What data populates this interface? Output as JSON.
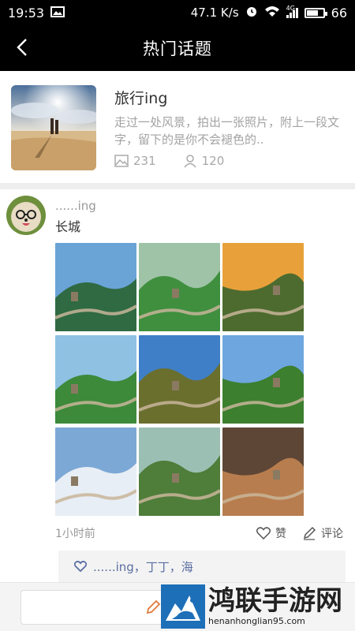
{
  "status": {
    "time": "19:53",
    "speed": "47.1 K/s",
    "network": "4G",
    "battery": "66",
    "battery_level": 0.66
  },
  "nav": {
    "title": "热门话题"
  },
  "topic": {
    "name": "旅行ing",
    "description": "走过一处风景，拍出一张照片，附上一段文字，留下的是你不会褪色的..",
    "photo_count": "231",
    "member_count": "120"
  },
  "post": {
    "username": "......ing",
    "content": "长城",
    "time": "1小时前",
    "like_label": "赞",
    "comment_label": "评论",
    "liked_by": "......ing，丁丁，海",
    "photos": [
      {
        "name": "photo-1",
        "sky": "#6aa3d6",
        "ground": "#2f6a42",
        "alt": "Great Wall ridge"
      },
      {
        "name": "photo-2",
        "sky": "#9fc3a6",
        "ground": "#3f8f3f",
        "alt": "Great Wall green hills"
      },
      {
        "name": "photo-3",
        "sky": "#e8a13a",
        "ground": "#4d6b2f",
        "alt": "Great Wall at sunset"
      },
      {
        "name": "photo-4",
        "sky": "#8fc1e3",
        "ground": "#3c8a3a",
        "alt": "Green mountains"
      },
      {
        "name": "photo-5",
        "sky": "#3f7fc7",
        "ground": "#6b6f2e",
        "alt": "Lake under blue sky"
      },
      {
        "name": "photo-6",
        "sky": "#6ea6e0",
        "ground": "#3c7f2e",
        "alt": "Watchtower"
      },
      {
        "name": "photo-7",
        "sky": "#7ca8d6",
        "ground": "#e8eef5",
        "alt": "Snowy Great Wall"
      },
      {
        "name": "photo-8",
        "sky": "#9bc0b3",
        "ground": "#4f7d3a",
        "alt": "Winding wall"
      },
      {
        "name": "photo-9",
        "sky": "#5d4636",
        "ground": "#b87d4e",
        "alt": "Old wall ruins"
      }
    ]
  },
  "watermark": {
    "title": "鸿联手游网",
    "url": "henanhonglian95.com"
  }
}
